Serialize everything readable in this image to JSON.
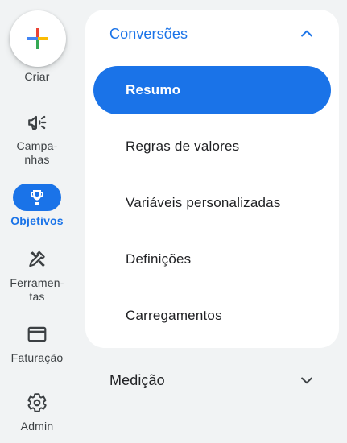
{
  "rail": {
    "create": {
      "label": "Criar",
      "icon": "plus-multicolor-icon"
    },
    "items": [
      {
        "label": "Campa-\nnhas",
        "icon": "megaphone-icon",
        "active": false
      },
      {
        "label": "Objetivos",
        "icon": "trophy-icon",
        "active": true
      },
      {
        "label": "Ferramen-\ntas",
        "icon": "tools-icon",
        "active": false
      },
      {
        "label": "Faturação",
        "icon": "credit-card-icon",
        "active": false
      },
      {
        "label": "Admin",
        "icon": "gear-icon",
        "active": false
      }
    ]
  },
  "subnav": {
    "conversions": {
      "title": "Conversões",
      "expanded": true,
      "items": [
        {
          "label": "Resumo",
          "selected": true
        },
        {
          "label": "Regras de valores",
          "selected": false
        },
        {
          "label": "Variáveis personalizadas",
          "selected": false
        },
        {
          "label": "Definições",
          "selected": false
        },
        {
          "label": "Carregamentos",
          "selected": false
        }
      ]
    },
    "measurement": {
      "title": "Medição",
      "expanded": false
    }
  },
  "colors": {
    "accent": "#1a73e8",
    "background": "#f1f3f4",
    "panel": "#ffffff",
    "text": "#202124",
    "rail_text": "#3c4043"
  }
}
